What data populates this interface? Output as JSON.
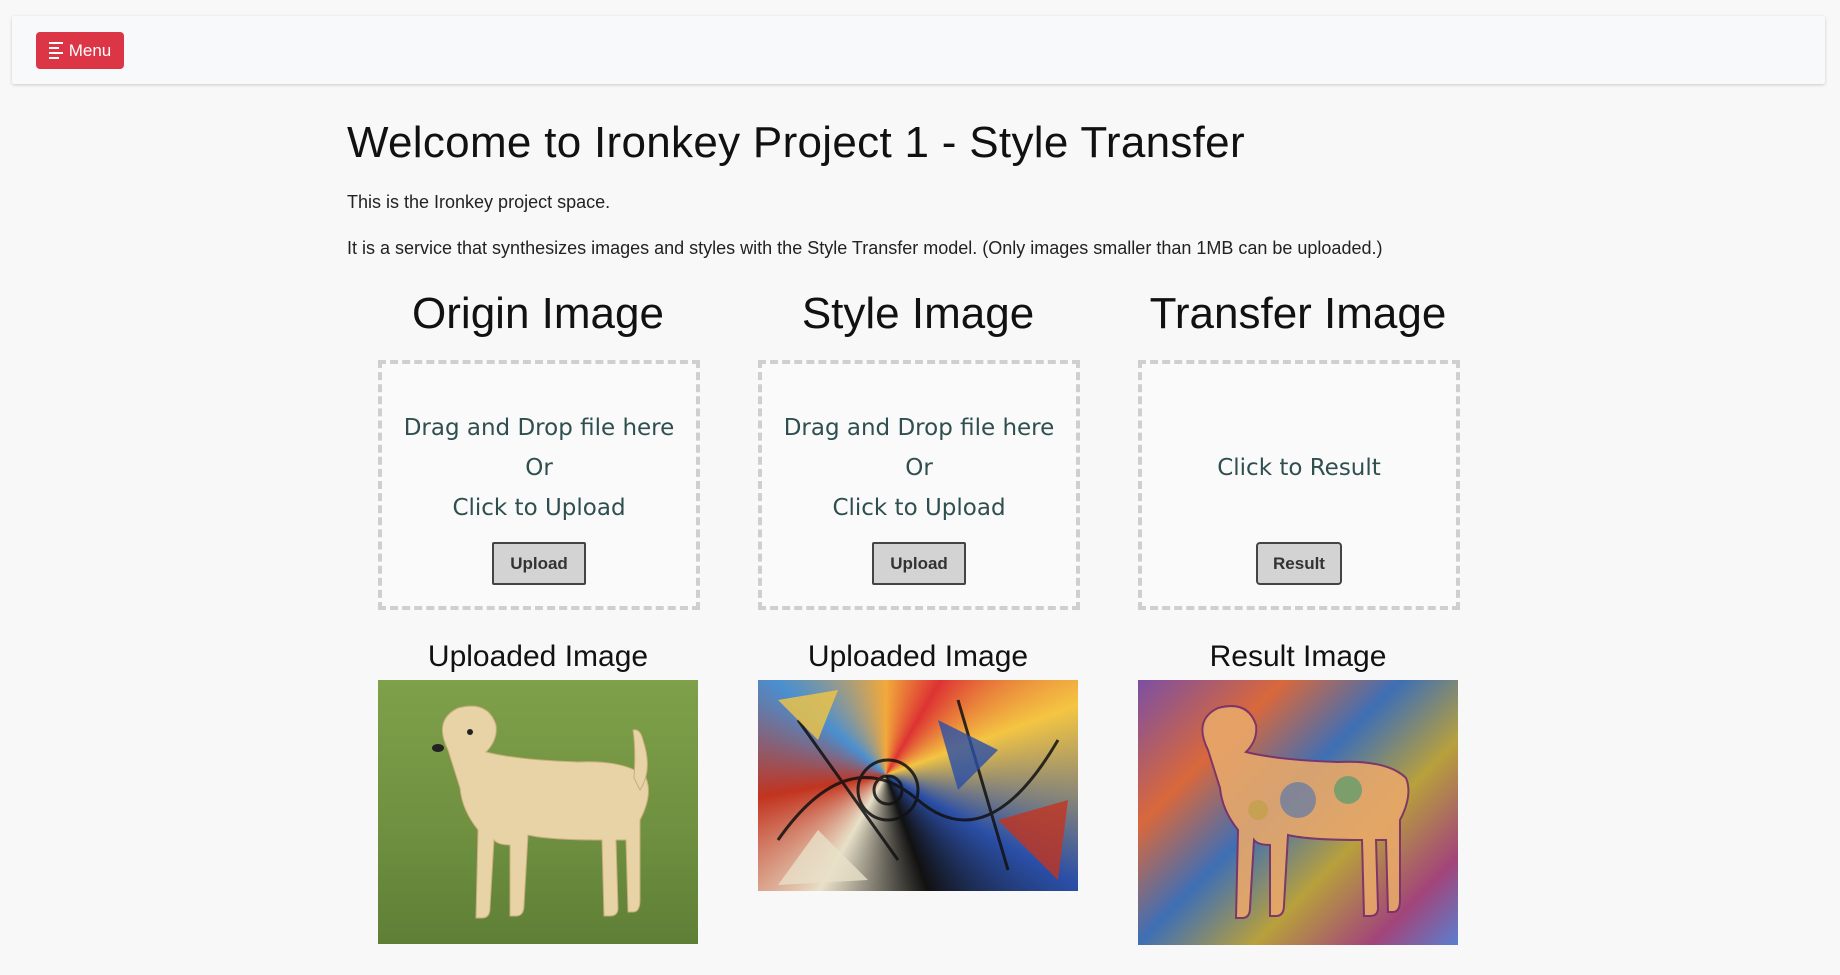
{
  "navbar": {
    "menu_label": "Menu"
  },
  "header": {
    "title": "Welcome to Ironkey Project 1 - Style Transfer",
    "intro": "This is the Ironkey project space.",
    "description": "It is a service that synthesizes images and styles with the Style Transfer model. (Only images smaller than 1MB can be uploaded.)"
  },
  "columns": [
    {
      "title": "Origin Image",
      "dropzone": {
        "line1": "Drag and Drop file here",
        "line2": "Or",
        "line3": "Click to Upload"
      },
      "button_label": "Upload",
      "sub_title": "Uploaded Image"
    },
    {
      "title": "Style Image",
      "dropzone": {
        "line1": "Drag and Drop file here",
        "line2": "Or",
        "line3": "Click to Upload"
      },
      "button_label": "Upload",
      "sub_title": "Uploaded Image"
    },
    {
      "title": "Transfer Image",
      "dropzone": {
        "line1": "Click to Result"
      },
      "button_label": "Result",
      "sub_title": "Result Image"
    }
  ],
  "colors": {
    "menu_button": "#dc3545",
    "dropzone_border": "#cfcfcf",
    "button_bg": "#d3d3d3"
  }
}
